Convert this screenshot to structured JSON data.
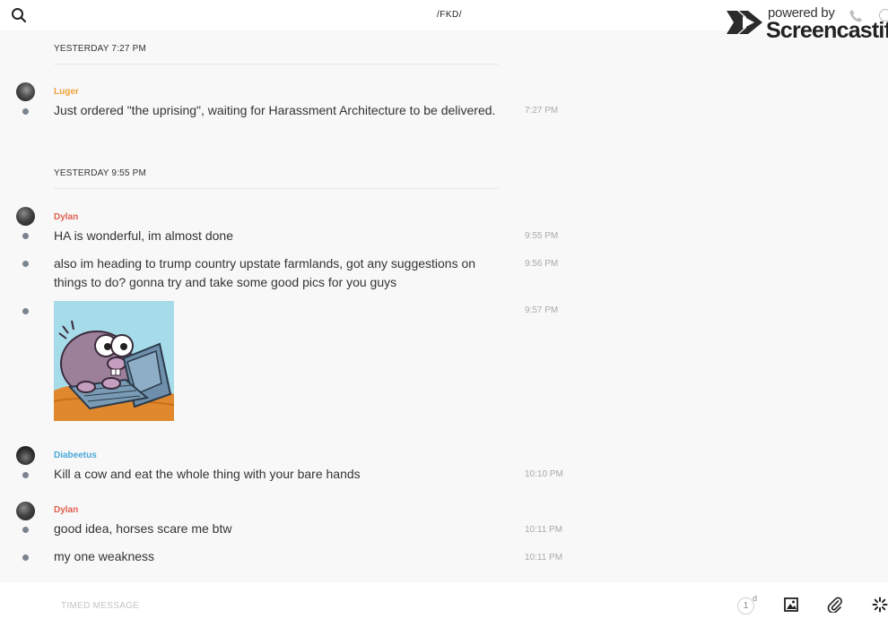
{
  "header": {
    "title": "/FKD/",
    "search_icon": "search-icon"
  },
  "watermark": {
    "line1": "powered by",
    "line2": "Screencastify"
  },
  "feed": {
    "separators": [
      {
        "label": "YESTERDAY 7:27 PM"
      },
      {
        "label": "YESTERDAY 9:55 PM"
      }
    ],
    "authors": {
      "luger": {
        "name": "Luger",
        "color": "#f0a23b"
      },
      "dylan": {
        "name": "Dylan",
        "color": "#e0604f"
      },
      "diabeetus": {
        "name": "Diabeetus",
        "color": "#4aa8d8"
      }
    },
    "messages": [
      {
        "text": "Just ordered \"the uprising\", waiting for Harassment Architecture to be delivered.",
        "time": "7:27 PM"
      },
      {
        "text": "HA is wonderful, im almost done",
        "time": "9:55 PM"
      },
      {
        "text": "also im heading to trump country upstate farmlands, got any suggestions on things to do? gonna try and take some good pics for you guys",
        "time": "9:56 PM"
      },
      {
        "text": "",
        "time": "9:57 PM",
        "image": "mole-at-computer-sticker"
      },
      {
        "text": "Kill a cow and eat the whole thing with your bare hands",
        "time": "10:10 PM"
      },
      {
        "text": "good idea, horses scare me btw",
        "time": "10:11 PM"
      },
      {
        "text": "my one weakness",
        "time": "10:11 PM"
      }
    ]
  },
  "composer": {
    "placeholder": "TIMED MESSAGE",
    "timer_value": "1",
    "timer_unit": "d",
    "icons": [
      "timer-icon",
      "image-icon",
      "paperclip-icon",
      "loading-spinner-icon"
    ]
  }
}
